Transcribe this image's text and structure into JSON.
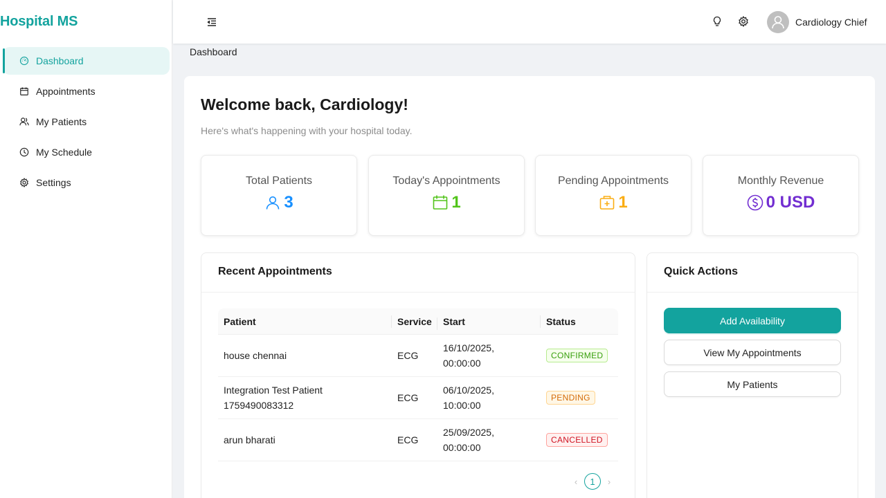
{
  "app": {
    "brand": "Hospital MS"
  },
  "sidebar": {
    "items": [
      {
        "label": "Dashboard",
        "icon": "dashboard-icon",
        "active": true
      },
      {
        "label": "Appointments",
        "icon": "calendar-icon"
      },
      {
        "label": "My Patients",
        "icon": "users-icon"
      },
      {
        "label": "My Schedule",
        "icon": "clock-icon"
      },
      {
        "label": "Settings",
        "icon": "gear-icon"
      }
    ]
  },
  "header": {
    "user_name": "Cardiology Chief",
    "icons": [
      "menu-fold-icon",
      "bulb-icon",
      "gear-icon",
      "avatar-icon"
    ]
  },
  "breadcrumb": "Dashboard",
  "welcome": {
    "title": "Welcome back, Cardiology!",
    "subtitle": "Here's what's happening with your hospital today."
  },
  "stats": [
    {
      "title": "Total Patients",
      "value": "3",
      "icon": "user-icon",
      "color": "#1890ff"
    },
    {
      "title": "Today's Appointments",
      "value": "1",
      "icon": "calendar-icon",
      "color": "#52c41a"
    },
    {
      "title": "Pending Appointments",
      "value": "1",
      "icon": "medicine-box-icon",
      "color": "#faad14"
    },
    {
      "title": "Monthly Revenue",
      "value": "0 USD",
      "icon": "dollar-icon",
      "color": "#722ed1"
    }
  ],
  "recent": {
    "title": "Recent Appointments",
    "columns": [
      "Patient",
      "Service",
      "Start",
      "Status"
    ],
    "rows": [
      {
        "patient": "house chennai",
        "service": "ECG",
        "date": "16/10/2025,",
        "time": "00:00:00",
        "status": "CONFIRMED"
      },
      {
        "patient_line1": "Integration Test Patient",
        "patient_line2": "1759490083312",
        "service": "ECG",
        "date": "06/10/2025,",
        "time": "10:00:00",
        "status": "PENDING"
      },
      {
        "patient": "arun bharati",
        "service": "ECG",
        "date": "25/09/2025,",
        "time": "00:00:00",
        "status": "CANCELLED"
      }
    ],
    "page": "1"
  },
  "quick_actions": {
    "title": "Quick Actions",
    "buttons": [
      "Add Availability",
      "View My Appointments",
      "My Patients"
    ]
  },
  "colors": {
    "primary": "#13a39e",
    "confirmed": "#389e0d",
    "pending": "#d46b08",
    "cancelled": "#cf1322"
  }
}
